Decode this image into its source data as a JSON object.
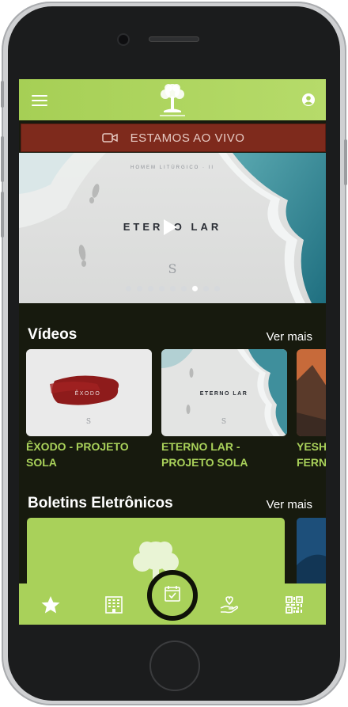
{
  "app": {
    "logo_alt": "tree-logo"
  },
  "live": {
    "label": "ESTAMOS AO VIVO"
  },
  "hero": {
    "subtitle": "HOMEM LITÚRGICO · II",
    "title": "ETERNO LAR",
    "slide_count": 9,
    "active_slide": 7
  },
  "videos": {
    "title": "Vídeos",
    "see_more": "Ver mais",
    "items": [
      {
        "caption": "ÊXODO - PROJETO SOLA",
        "thumb_text": "ÊXODO"
      },
      {
        "caption": "ETERNO LAR - PROJETO SOLA",
        "thumb_text": "ETERNO LAR"
      },
      {
        "caption": "YESHU FERNA"
      }
    ]
  },
  "bulletins": {
    "title": "Boletins Eletrônicos",
    "see_more": "Ver mais"
  },
  "tabbar": {
    "items": [
      "star-icon",
      "building-icon",
      "calendar-check-icon",
      "hand-heart-icon",
      "qr-code-icon"
    ]
  },
  "colors": {
    "accent": "#a9d15a",
    "live_bg": "#7e2a1c",
    "background": "#171a0e"
  }
}
